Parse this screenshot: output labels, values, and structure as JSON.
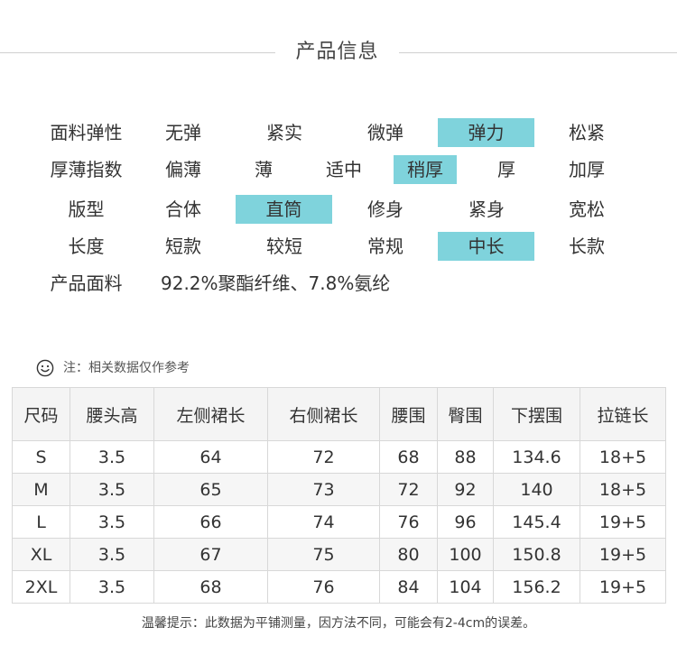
{
  "section_title": "产品信息",
  "attributes": [
    {
      "label": "面料弹性",
      "options": [
        "无弹",
        "紧实",
        "微弹",
        "弹力",
        "松紧"
      ],
      "selected": 3
    },
    {
      "label": "厚薄指数",
      "options": [
        "偏薄",
        "薄",
        "适中",
        "稍厚",
        "厚",
        "加厚"
      ],
      "selected": 3
    },
    {
      "label": "版型",
      "options": [
        "合体",
        "直筒",
        "修身",
        "紧身",
        "宽松"
      ],
      "selected": 1
    },
    {
      "label": "长度",
      "options": [
        "短款",
        "较短",
        "常规",
        "中长",
        "长款"
      ],
      "selected": 3
    }
  ],
  "material": {
    "label": "产品面料",
    "value": "92.2%聚酯纤维、7.8%氨纶"
  },
  "note": {
    "icon": "smile-icon",
    "text": "注：相关数据仅作参考"
  },
  "size_table": {
    "headers": [
      "尺码",
      "腰头高",
      "左侧裙长",
      "右侧裙长",
      "腰围",
      "臀围",
      "下摆围",
      "拉链长"
    ],
    "rows": [
      [
        "S",
        "3.5",
        "64",
        "72",
        "68",
        "88",
        "134.6",
        "18+5"
      ],
      [
        "M",
        "3.5",
        "65",
        "73",
        "72",
        "92",
        "140",
        "18+5"
      ],
      [
        "L",
        "3.5",
        "66",
        "74",
        "76",
        "96",
        "145.4",
        "19+5"
      ],
      [
        "XL",
        "3.5",
        "67",
        "75",
        "80",
        "100",
        "150.8",
        "19+5"
      ],
      [
        "2XL",
        "3.5",
        "68",
        "76",
        "84",
        "104",
        "156.2",
        "19+5"
      ]
    ]
  },
  "footnote": "温馨提示：此数据为平铺测量，因方法不同，可能会有2-4cm的误差。",
  "colors": {
    "highlight": "#7fd3dc",
    "divider": "#cfcfcf",
    "table_border": "#d8d8d8"
  }
}
